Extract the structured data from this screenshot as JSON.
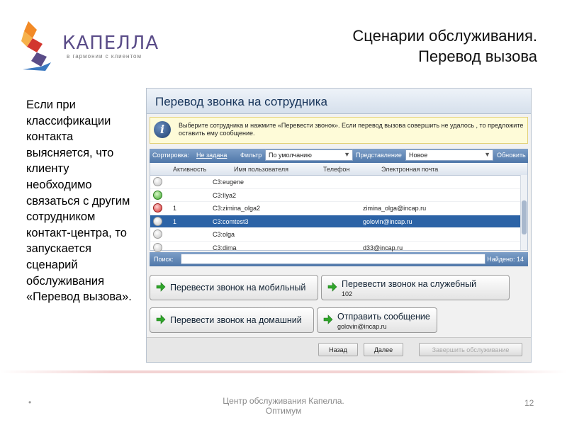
{
  "logo": {
    "name": "КАПЕЛЛА",
    "tagline": "в гармонии с клиентом"
  },
  "slide_title": {
    "line1": "Сценарии обслуживания.",
    "line2": "Перевод вызова"
  },
  "side_text": "Если при классификации контакта выясняется, что клиенту необходимо связаться с другим сотрудником контакт-центра, то запускается сценарий обслуживания «Перевод вызова».",
  "app": {
    "title": "Перевод звонка на сотрудника",
    "hint": "Выберите сотрудника и нажмите «Перевести звонок». Если перевод вызова совершить не удалось , то предложите оставить ему сообщение.",
    "toolbar": {
      "sort_label": "Сортировка:",
      "sort_value": "Не задана",
      "filter_label": "Фильтр",
      "filter_value": "По умолчанию",
      "view_label": "Представление",
      "view_value": "Новое",
      "refresh": "Обновить"
    },
    "columns": [
      "Активность",
      "Имя пользователя",
      "Телефон",
      "Электронная почта"
    ],
    "rows": [
      {
        "status": "grey",
        "activity": "",
        "user": "C3:eugene",
        "phone": "",
        "email": "",
        "selected": false
      },
      {
        "status": "green",
        "activity": "",
        "user": "C3:Ilya2",
        "phone": "",
        "email": "",
        "selected": false
      },
      {
        "status": "red",
        "activity": "1",
        "user": "C3:zimina_olga2",
        "phone": "",
        "email": "zimina_olga@incap.ru",
        "selected": false
      },
      {
        "status": "grey",
        "activity": "1",
        "user": "C3:comtest3",
        "phone": "",
        "email": "golovin@incap.ru",
        "selected": true
      },
      {
        "status": "grey",
        "activity": "",
        "user": "C3:olga",
        "phone": "",
        "email": "",
        "selected": false
      },
      {
        "status": "grey",
        "activity": "",
        "user": "C3:dima",
        "phone": "",
        "email": "d33@incap.ru",
        "selected": false
      }
    ],
    "search": {
      "label": "Поиск:",
      "value": "",
      "found": "Найдено: 14"
    },
    "actions": {
      "to_mobile": "Перевести звонок на мобильный",
      "to_work": "Перевести звонок на служебный",
      "to_work_sub": "102",
      "to_home": "Перевести звонок на домашний",
      "send_message": "Отправить сообщение",
      "send_message_sub": "golovin@incap.ru"
    },
    "nav": {
      "back": "Назад",
      "next": "Далее",
      "finish": "Завершить обслуживание"
    }
  },
  "footer": {
    "bullet": "•",
    "center": "Центр обслуживания Капелла. Оптимум",
    "page": "12"
  },
  "colors": {
    "brand_purple": "#5a4c88",
    "brand_orange": "#f28a26",
    "selection": "#2c63a6",
    "toolbar": "#5d84b5",
    "hint_bg": "#fefbd8"
  }
}
